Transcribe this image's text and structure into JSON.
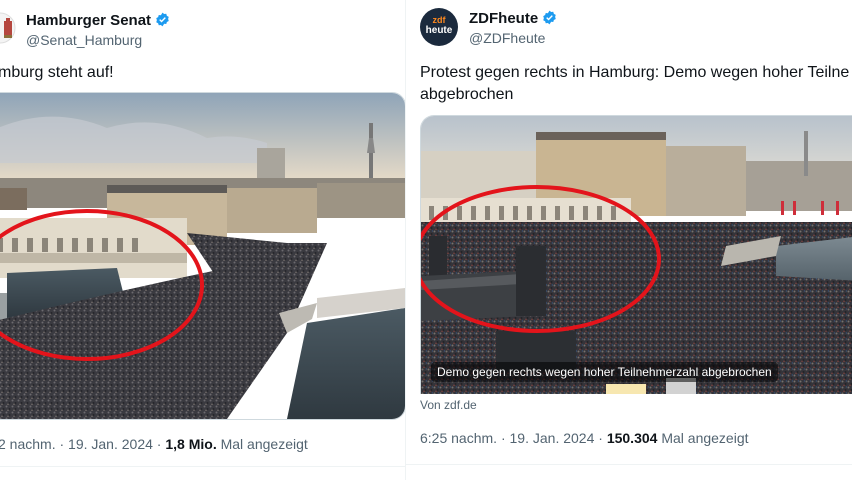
{
  "left_tweet": {
    "name": "Hamburger Senat",
    "handle": "@Senat_Hamburg",
    "text": "mburg steht auf!",
    "time": "2 nachm.",
    "date": "19. Jan. 2024",
    "views": "1,8 Mio.",
    "views_label": "Mal angezeigt"
  },
  "right_tweet": {
    "name": "ZDFheute",
    "handle": "@ZDFheute",
    "avatar_text_top": "zdf",
    "avatar_text_bottom": "heute",
    "text_line1": "Protest gegen rechts in Hamburg: Demo wegen hoher Teilne",
    "text_line2": "abgebrochen",
    "image_caption": "Demo gegen rechts wegen hoher Teilnehmerzahl abgebrochen",
    "source": "Von zdf.de",
    "time": "6:25 nachm.",
    "date": "19. Jan. 2024",
    "views": "150.304",
    "views_label": "Mal angezeigt"
  },
  "separator": "·",
  "colors": {
    "verified": "#1d9bf0",
    "highlight_circle": "#e3141b",
    "zdf_avatar": "#1b2a3d"
  }
}
